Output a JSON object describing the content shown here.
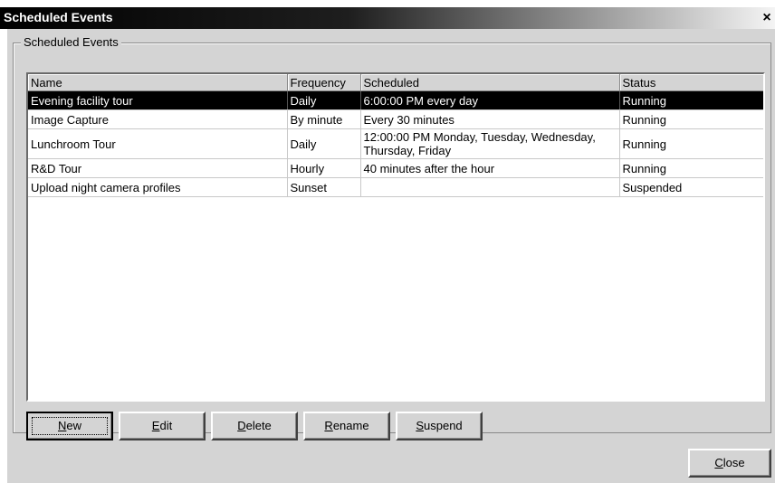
{
  "window": {
    "title": "Scheduled Events",
    "close_glyph": "×"
  },
  "group": {
    "label": "Scheduled Events"
  },
  "table": {
    "columns": [
      "Name",
      "Frequency",
      "Scheduled",
      "Status"
    ],
    "rows": [
      {
        "name": "Evening facility tour",
        "frequency": "Daily",
        "scheduled": "6:00:00 PM every day",
        "status": "Running",
        "selected": true
      },
      {
        "name": "Image Capture",
        "frequency": "By minute",
        "scheduled": "Every 30 minutes",
        "status": "Running"
      },
      {
        "name": "Lunchroom Tour",
        "frequency": "Daily",
        "scheduled": "12:00:00 PM Monday, Tuesday, Wednesday, Thursday, Friday",
        "status": "Running"
      },
      {
        "name": "R&D Tour",
        "frequency": "Hourly",
        "scheduled": "40 minutes after the hour",
        "status": "Running"
      },
      {
        "name": "Upload night camera profiles",
        "frequency": "Sunset",
        "scheduled": "",
        "status": "Suspended"
      }
    ]
  },
  "buttons": {
    "new": {
      "mnemonic": "N",
      "rest": "ew"
    },
    "edit": {
      "mnemonic": "E",
      "rest": "dit"
    },
    "delete": {
      "mnemonic": "D",
      "rest": "elete"
    },
    "rename": {
      "mnemonic": "R",
      "rest": "ename"
    },
    "suspend": {
      "mnemonic": "S",
      "rest": "uspend"
    },
    "close": {
      "mnemonic": "C",
      "rest": "lose"
    }
  }
}
